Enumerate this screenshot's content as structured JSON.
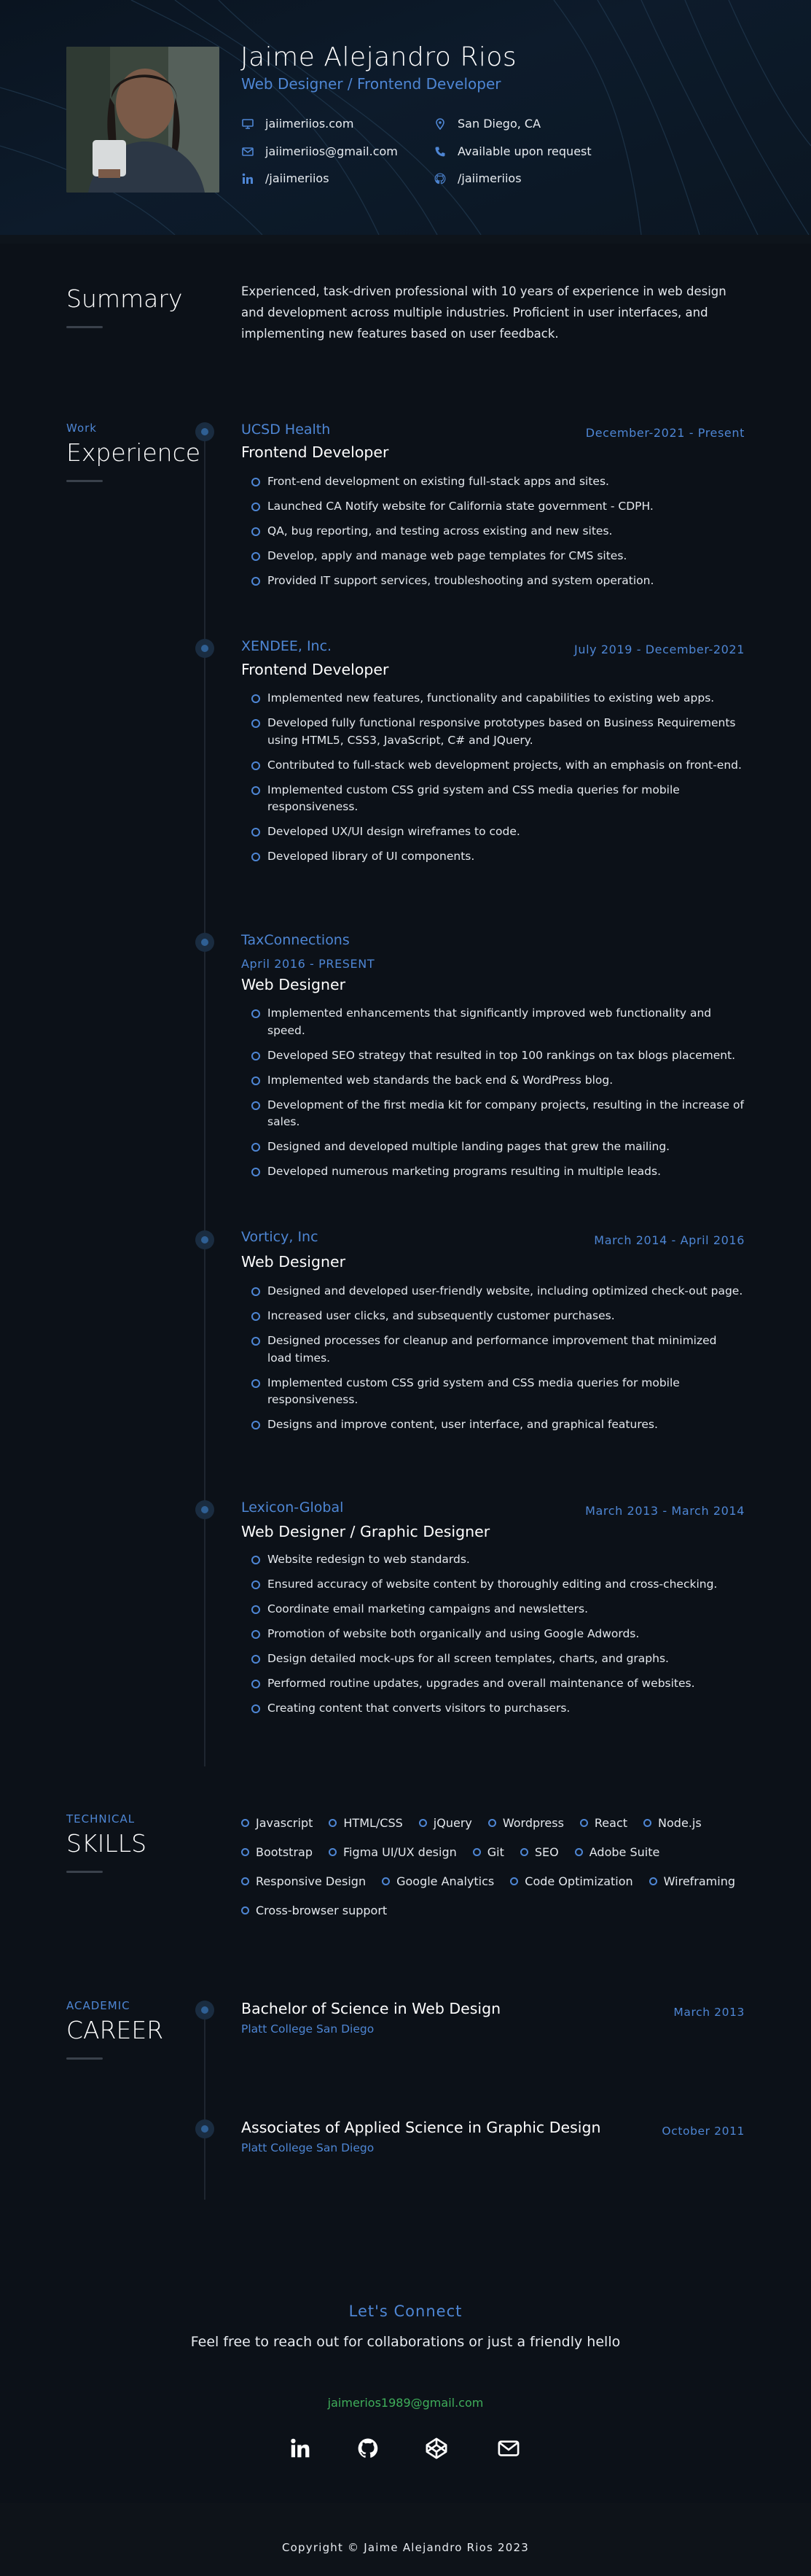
{
  "header": {
    "name": "Jaime Alejandro Rios",
    "role": "Web Designer / Frontend Developer",
    "contacts": [
      {
        "icon": "monitor-icon",
        "text": "jaiimeriios.com"
      },
      {
        "icon": "map-pin-icon",
        "text": "San Diego, CA"
      },
      {
        "icon": "envelope-icon",
        "text": "jaiimeriios@gmail.com"
      },
      {
        "icon": "phone-icon",
        "text": "Available upon request"
      },
      {
        "icon": "linkedin-icon",
        "text": "/jaiimeriios"
      },
      {
        "icon": "github-icon",
        "text": "/jaiimeriios"
      }
    ]
  },
  "summary": {
    "title": "Summary",
    "text": "Experienced, task-driven professional with 10 years of experience in web design and development across multiple industries. Proficient in user interfaces, and implementing new features based on user feedback."
  },
  "experience": {
    "kicker": "Work",
    "title": "Experience",
    "jobs": [
      {
        "company": "UCSD Health",
        "dates": "December-2021 - Present",
        "role": "Frontend Developer",
        "points": [
          "Front-end development on existing full-stack apps and sites.",
          "Launched CA Notify website for California state government - CDPH.",
          "QA, bug reporting, and testing across existing and new sites.",
          "Develop, apply and manage web page templates for CMS sites.",
          "Provided IT support services, troubleshooting and system operation."
        ]
      },
      {
        "company": "XENDEE, Inc.",
        "dates": "July 2019 - December-2021",
        "role": "Frontend Developer",
        "points": [
          "Implemented new features, functionality and capabilities to existing web apps.",
          "Developed fully functional responsive prototypes based on Business Requirements using HTML5, CSS3, JavaScript, C# and JQuery.",
          "Contributed to full-stack web development projects, with an emphasis on front-end.",
          "Implemented custom CSS grid system and CSS media queries for mobile responsiveness.",
          "Developed UX/UI design wireframes to code.",
          "Developed library of UI components."
        ]
      },
      {
        "company": "TaxConnections",
        "dates": "April 2016 - PRESENT",
        "role": "Web Designer",
        "points": [
          "Implemented enhancements that significantly improved web functionality and speed.",
          "Developed SEO strategy that resulted in top 100 rankings on tax blogs placement.",
          "Implemented web standards the back end & WordPress blog.",
          "Development of the first media kit for company projects, resulting in the increase of sales.",
          "Designed and developed multiple landing pages that grew the mailing.",
          "Developed numerous marketing programs resulting in multiple leads."
        ]
      },
      {
        "company": "Vorticy, Inc",
        "dates": "March 2014 - April 2016",
        "role": "Web Designer",
        "points": [
          "Designed and developed user-friendly website, including optimized check-out page.",
          "Increased user clicks, and subsequently customer purchases.",
          "Designed processes for cleanup and performance improvement that minimized load times.",
          "Implemented custom CSS grid system and CSS media queries for mobile responsiveness.",
          "Designs and improve content, user interface, and graphical features."
        ]
      },
      {
        "company": "Lexicon-Global",
        "dates": "March 2013 - March 2014",
        "role": "Web Designer / Graphic Designer",
        "points": [
          "Website redesign to web standards.",
          "Ensured accuracy of website content by thoroughly editing and cross-checking.",
          "Coordinate email marketing campaigns and newsletters.",
          "Promotion of website both organically and using Google Adwords.",
          "Design detailed mock-ups for all screen templates, charts, and graphs.",
          "Performed routine updates, upgrades and overall maintenance of websites.",
          "Creating content that converts visitors to purchasers."
        ]
      }
    ]
  },
  "skills": {
    "kicker": "TECHNICAL",
    "title": "SKILLS",
    "items": [
      "Javascript",
      "HTML/CSS",
      "jQuery",
      "Wordpress",
      "React",
      "Node.js",
      "Bootstrap",
      "Figma UI/UX design",
      "Git",
      "SEO",
      "Adobe Suite",
      "Responsive Design",
      "Google Analytics",
      "Code Optimization",
      "Wireframing",
      "Cross-browser support"
    ]
  },
  "career": {
    "kicker": "ACADEMIC",
    "title": "CAREER",
    "items": [
      {
        "degree": "Bachelor of Science in Web Design",
        "school": "Platt College San Diego",
        "date": "March 2013"
      },
      {
        "degree": "Associates of Applied Science in Graphic Design",
        "school": "Platt College San Diego",
        "date": "October 2011"
      }
    ]
  },
  "connect": {
    "title": "Let's Connect",
    "subtitle": "Feel free to reach out for collaborations or just a friendly hello",
    "email": "jaimerios1989@gmail.com",
    "socials": [
      "linkedin-icon",
      "github-icon",
      "codepen-icon",
      "envelope-icon"
    ]
  },
  "footer": {
    "text": "Copyright © Jaime Alejandro Rios 2023"
  },
  "colors": {
    "background": "#0c1118",
    "accent": "#4e86d4",
    "email": "#3fae5a"
  }
}
